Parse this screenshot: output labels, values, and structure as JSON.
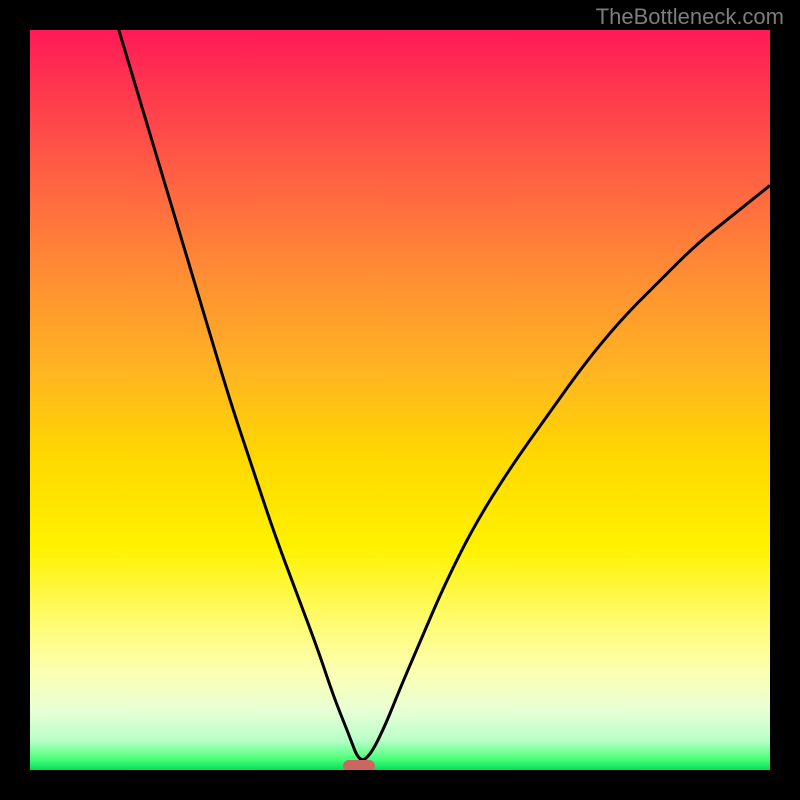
{
  "watermark": "TheBottleneck.com",
  "chart_data": {
    "type": "line",
    "title": "",
    "xlabel": "",
    "ylabel": "",
    "xlim": [
      0,
      100
    ],
    "ylim": [
      0,
      100
    ],
    "background_gradient": {
      "top_color": "#ff1a57",
      "mid_color": "#fff200",
      "bottom_color": "#00de5a"
    },
    "series": [
      {
        "name": "curve",
        "color": "#000000",
        "x": [
          12,
          15,
          18,
          21,
          24,
          27,
          30,
          33,
          36,
          39,
          41,
          43,
          44.5,
          46,
          48,
          50,
          53,
          56,
          60,
          65,
          70,
          75,
          80,
          85,
          90,
          95,
          100
        ],
        "y": [
          100,
          90,
          80,
          70,
          60,
          50,
          41,
          32,
          24,
          16,
          10,
          5,
          1,
          2,
          6,
          11,
          18,
          25,
          33,
          41,
          48,
          55,
          61,
          66,
          71,
          75,
          79
        ]
      }
    ],
    "marker": {
      "x": 44.5,
      "y": 0,
      "color": "#cc6660"
    }
  }
}
